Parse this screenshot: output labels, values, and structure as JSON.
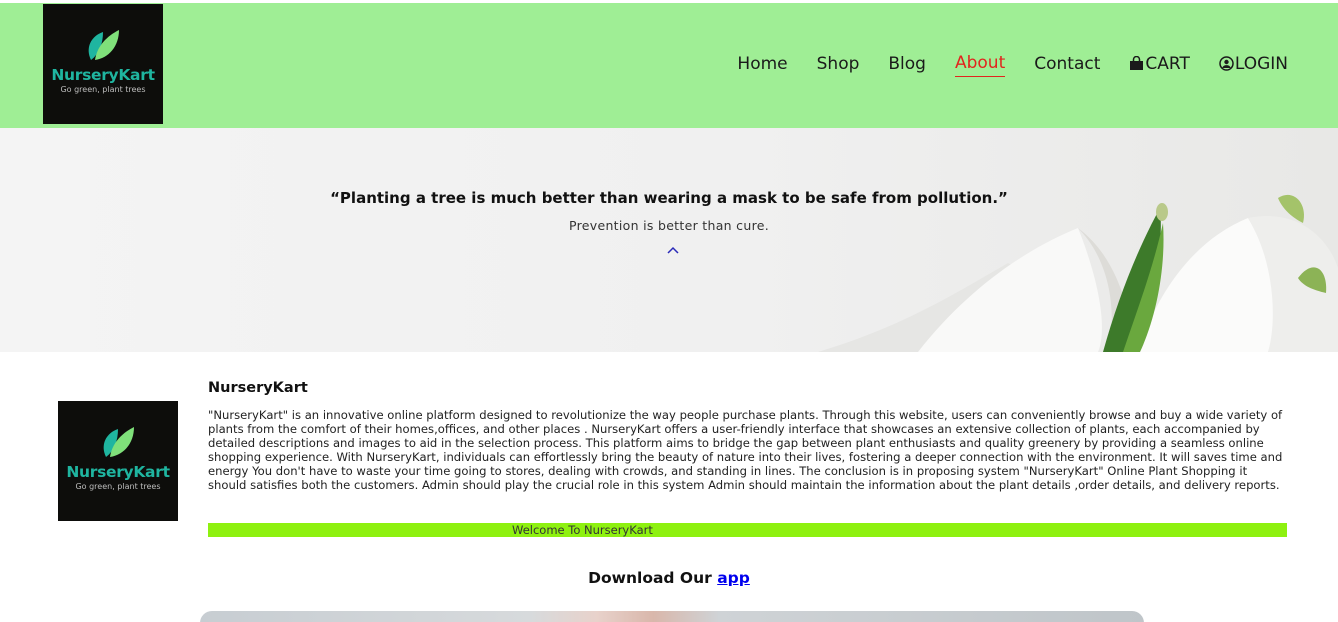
{
  "header": {
    "logo": {
      "brand": "NurseryKart",
      "tagline": "Go green, plant trees"
    },
    "nav": [
      {
        "label": "Home"
      },
      {
        "label": "Shop"
      },
      {
        "label": "Blog"
      },
      {
        "label": "About",
        "active": true
      },
      {
        "label": "Contact"
      },
      {
        "label": "CART",
        "icon": "shopping-bag-icon"
      },
      {
        "label": "LOGIN",
        "icon": "user-circle-icon"
      }
    ],
    "colors": {
      "bar": "#9fee95",
      "active": "#e2241d"
    }
  },
  "hero": {
    "quote": "“Planting a tree is much better than wearing a mask to be safe from pollution.”",
    "subtitle": "Prevention is better than cure.",
    "scroll_icon": "chevron-up-icon"
  },
  "about": {
    "logo": {
      "brand": "NurseryKart",
      "tagline": "Go green, plant trees"
    },
    "title": "NurseryKart",
    "description": "\"NurseryKart\" is an innovative online platform designed to revolutionize the way people purchase plants. Through this website, users can conveniently browse and buy a wide variety of plants from the comfort of their homes,offices, and other places . NurseryKart offers a user-friendly interface that showcases an extensive collection of plants, each accompanied by detailed descriptions and images to aid in the selection process. This platform aims to bridge the gap between plant enthusiasts and quality greenery by providing a seamless online shopping experience. With NurseryKart, individuals can effortlessly bring the beauty of nature into their lives, fostering a deeper connection with the environment. It will saves time and energy You don't have to waste your time going to stores, dealing with crowds, and standing in lines. The conclusion is in proposing system \"NurseryKart\" Online Plant Shopping it should satisfies both the customers. Admin should play the crucial role in this system Admin should maintain the information about the plant details ,order details, and delivery reports.",
    "marquee": "Welcome To NurseryKart",
    "marquee_color": "#8ef110"
  },
  "download": {
    "text": "Download Our",
    "link": "app"
  }
}
